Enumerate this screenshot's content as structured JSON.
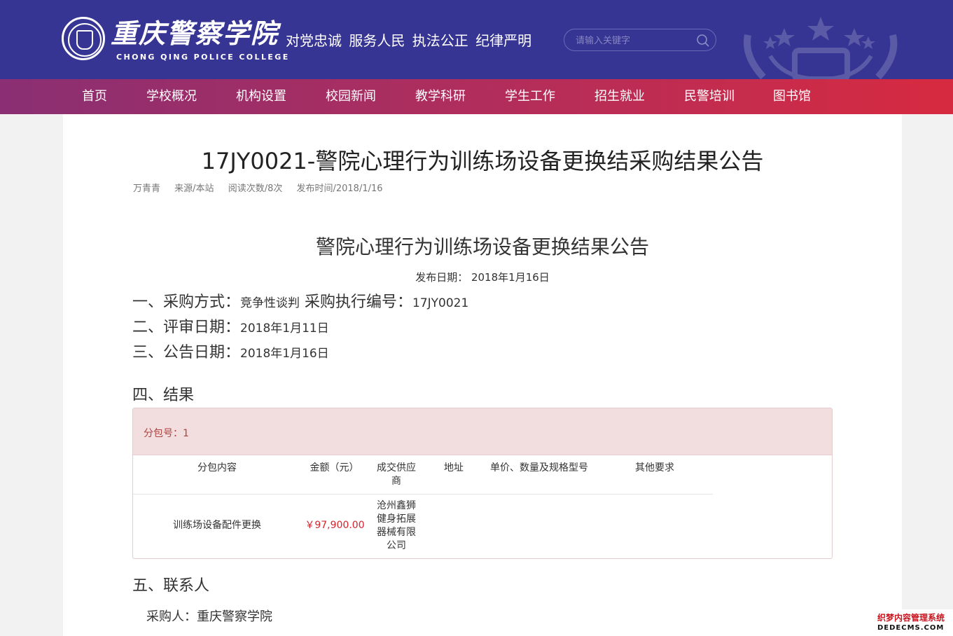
{
  "header": {
    "logo_text": "重庆警察学院",
    "logo_en": "CHONG QING POLICE COLLEGE",
    "slogan": "对党忠诚 服务人民 执法公正 纪律严明",
    "search_placeholder": "请输入关键字"
  },
  "nav": {
    "items": [
      "首页",
      "学校概况",
      "机构设置",
      "校园新闻",
      "教学科研",
      "学生工作",
      "招生就业",
      "民警培训",
      "图书馆"
    ]
  },
  "article": {
    "title": "17JY0021-警院心理行为训练场设备更换结采购结果公告",
    "meta": {
      "author": "万青青",
      "source": "来源/本站",
      "views": "阅读次数/8次",
      "date": "发布时间/2018/1/16"
    },
    "sub_title": "警院心理行为训练场设备更换结果公告",
    "pub_date": "发布日期： 2018年1月16日",
    "sections": {
      "s1_label": "一、采购方式：",
      "s1_method": "竞争性谈判",
      "s1_code_label": " 采购执行编号：",
      "s1_code": "17JY0021",
      "s2_label": "二、评审日期：",
      "s2_value": "2018年1月11日",
      "s3_label": "三、公告日期：",
      "s3_value": "2018年1月16日",
      "s4_label": "四、结果",
      "s5_label": "五、联系人"
    },
    "result": {
      "package": "分包号：1",
      "headers": [
        "分包内容",
        "金额（元）",
        "成交供应商",
        "地址",
        "单价、数量及规格型号",
        "其他要求"
      ],
      "row": {
        "content": "训练场设备配件更换",
        "amount": "￥97,900.00",
        "supplier": "沧州鑫狮健身拓展器械有限公司",
        "address": "",
        "spec": "",
        "other": ""
      }
    },
    "contact": "采购人：重庆警察学院"
  },
  "watermark": {
    "line1": "织梦内容管理系统",
    "line2": "DEDECMS.COM"
  },
  "colors": {
    "header_bg": "#373593",
    "nav_start": "#8a2f73",
    "nav_end": "#d72a40",
    "panel_head_bg": "#f2dede",
    "panel_head_text": "#a94442",
    "price": "#d9232d"
  }
}
